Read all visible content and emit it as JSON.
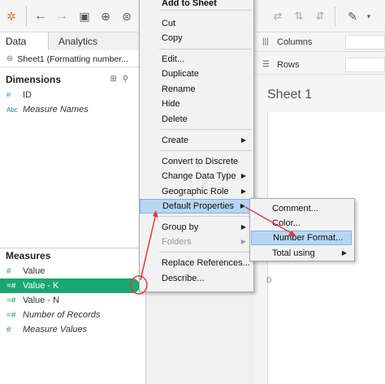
{
  "tabs": {
    "data": "Data",
    "analytics": "Analytics"
  },
  "datasource": {
    "name": "Sheet1 (Formatting number..."
  },
  "dimensions": {
    "title": "Dimensions",
    "tools": "⊞ ⚲",
    "fields": [
      {
        "icon": "#",
        "label": "ID"
      },
      {
        "icon": "Abc",
        "label": "Measure Names"
      }
    ]
  },
  "measures": {
    "title": "Measures",
    "fields": [
      {
        "icon": "#",
        "label": "Value"
      },
      {
        "icon": "=#",
        "label": "Value - K"
      },
      {
        "icon": "=#",
        "label": "Value - N"
      },
      {
        "icon": "=#",
        "label": "Number of Records"
      },
      {
        "icon": "#",
        "label": "Measure Values"
      }
    ]
  },
  "shelves": {
    "columns": "Columns",
    "rows": "Rows"
  },
  "sheet": {
    "title": "Sheet 1",
    "axis_letter": "D"
  },
  "context_menu": {
    "items": [
      {
        "label": "Add to Sheet"
      },
      {
        "label": "Cut"
      },
      {
        "label": "Copy"
      },
      {
        "label": "Edit..."
      },
      {
        "label": "Duplicate"
      },
      {
        "label": "Rename"
      },
      {
        "label": "Hide"
      },
      {
        "label": "Delete"
      },
      {
        "label": "Create"
      },
      {
        "label": "Convert to Discrete"
      },
      {
        "label": "Change Data Type"
      },
      {
        "label": "Geographic Role"
      },
      {
        "label": "Default Properties"
      },
      {
        "label": "Group by"
      },
      {
        "label": "Folders"
      },
      {
        "label": "Replace References..."
      },
      {
        "label": "Describe..."
      }
    ]
  },
  "submenu": {
    "items": [
      {
        "label": "Comment..."
      },
      {
        "label": "Color..."
      },
      {
        "label": "Number Format..."
      },
      {
        "label": "Total using"
      }
    ]
  },
  "colors": {
    "selected_field": "#1aa774",
    "annotation": "#e03a3a",
    "menu_highlight": "#b8d6f3"
  }
}
